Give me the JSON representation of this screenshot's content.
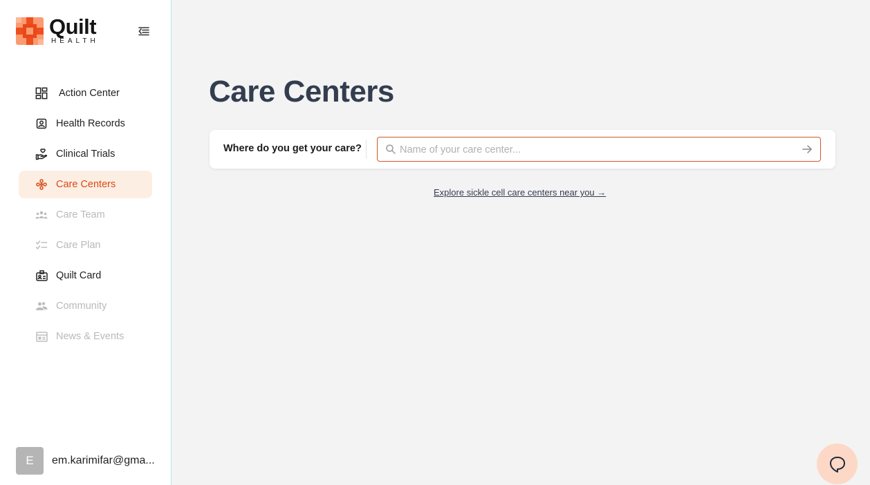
{
  "brand": {
    "name": "Quilt",
    "tagline": "HEALTH"
  },
  "nav": {
    "items": [
      {
        "label": "Action Center",
        "icon": "dashboard-icon",
        "state": "normal"
      },
      {
        "label": "Health Records",
        "icon": "id-badge-icon",
        "state": "normal"
      },
      {
        "label": "Clinical Trials",
        "icon": "hand-heart-icon",
        "state": "normal"
      },
      {
        "label": "Care Centers",
        "icon": "care-centers-icon",
        "state": "active"
      },
      {
        "label": "Care Team",
        "icon": "team-icon",
        "state": "disabled"
      },
      {
        "label": "Care Plan",
        "icon": "checklist-icon",
        "state": "disabled"
      },
      {
        "label": "Quilt Card",
        "icon": "card-icon",
        "state": "normal"
      },
      {
        "label": "Community",
        "icon": "community-icon",
        "state": "disabled"
      },
      {
        "label": "News & Events",
        "icon": "news-icon",
        "state": "disabled"
      }
    ]
  },
  "user": {
    "initial": "E",
    "email": "em.karimifar@gma..."
  },
  "main": {
    "title": "Care Centers",
    "search": {
      "label": "Where do you get your care?",
      "placeholder": "Name of your care center..."
    },
    "explore_link": "Explore sickle cell care centers near you →"
  },
  "colors": {
    "accent": "#d84a15",
    "active_bg": "#fdeee4",
    "title": "#333d4f",
    "chat_bg": "#fdd8c6"
  }
}
